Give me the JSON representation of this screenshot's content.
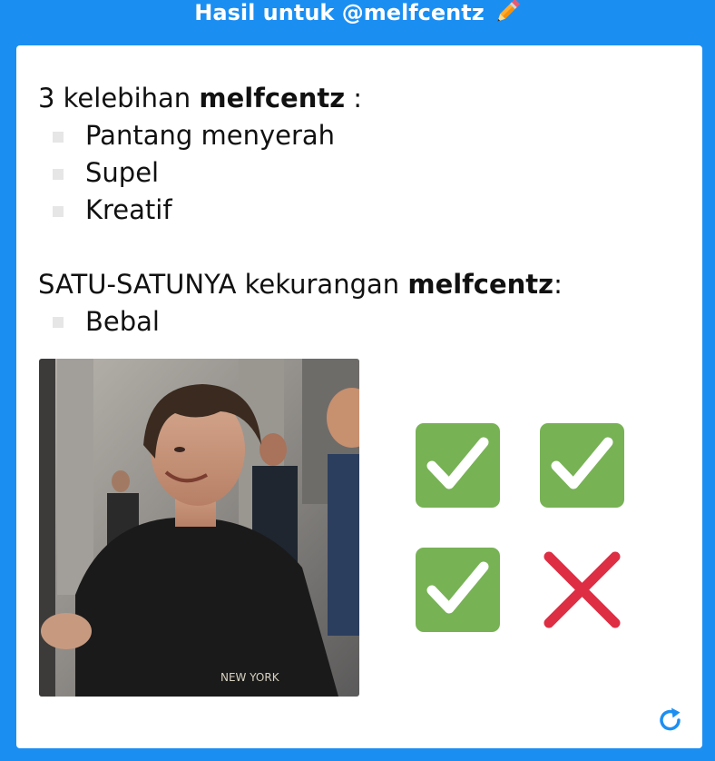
{
  "header": {
    "title": "Hasil untuk @melfcentz",
    "icon": "pencil-icon"
  },
  "card": {
    "strengths_prefix": "3 kelebihan ",
    "strengths_name": "melfcentz",
    "strengths_suffix": " :",
    "strengths": [
      "Pantang menyerah",
      "Supel",
      "Kreatif"
    ],
    "weakness_prefix": "SATU-SATUNYA kekurangan ",
    "weakness_name": "melfcentz",
    "weakness_suffix": ":",
    "weaknesses": [
      "Bebal"
    ],
    "photo_icon": "profile-photo",
    "marks": [
      "check",
      "check",
      "check",
      "cross"
    ],
    "refresh_icon": "refresh-icon"
  },
  "colors": {
    "frame": "#1b8ef2",
    "check_bg": "#77b255",
    "cross": "#dd2e44",
    "refresh": "#1d8ff2"
  }
}
